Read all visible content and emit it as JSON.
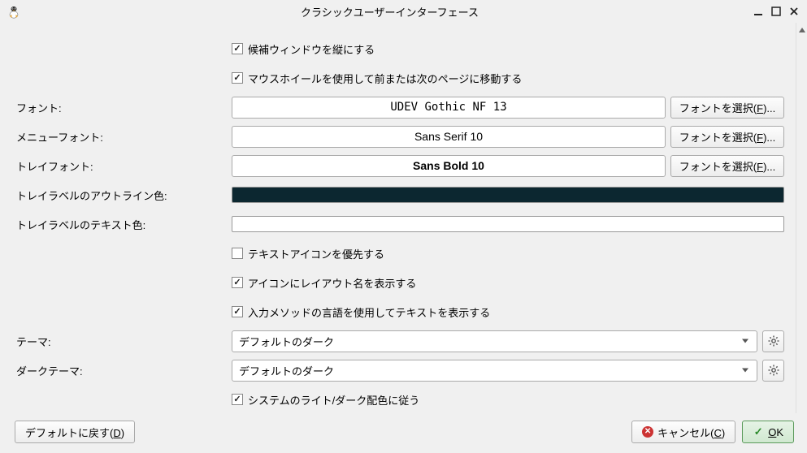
{
  "window": {
    "title": "クラシックユーザーインターフェース"
  },
  "checkboxes": {
    "vertical_candidate": {
      "label": "候補ウィンドウを縦にする",
      "checked": true
    },
    "wheel_paging": {
      "label": "マウスホイールを使用して前または次のページに移動する",
      "checked": true
    },
    "prefer_text_icon": {
      "label": "テキストアイコンを優先する",
      "checked": false
    },
    "show_layout_name": {
      "label": "アイコンにレイアウト名を表示する",
      "checked": true
    },
    "use_im_language": {
      "label": "入力メソッドの言語を使用してテキストを表示する",
      "checked": true
    },
    "follow_system_theme": {
      "label": "システムのライト/ダーク配色に従う",
      "checked": true
    }
  },
  "labels": {
    "font": "フォント:",
    "menu_font": "メニューフォント:",
    "tray_font": "トレイフォント:",
    "tray_outline_color": "トレイラベルのアウトライン色:",
    "tray_text_color": "トレイラベルのテキスト色:",
    "theme": "テーマ:",
    "dark_theme": "ダークテーマ:"
  },
  "fonts": {
    "main": "UDEV Gothic NF 13",
    "menu": "Sans Serif 10",
    "tray": "Sans Bold 10"
  },
  "colors": {
    "tray_outline": "#0c2730",
    "tray_text": "#ffffff"
  },
  "buttons": {
    "font_select_prefix": "フォントを選択(",
    "font_select_letter": "F",
    "font_select_suffix": ")...",
    "reset_default_prefix": "デフォルトに戻す(",
    "reset_default_letter": "D",
    "reset_default_suffix": ")",
    "cancel_prefix": "キャンセル(",
    "cancel_letter": "C",
    "cancel_suffix": ")",
    "ok_letter": "O",
    "ok_suffix": "K"
  },
  "theme": {
    "value": "デフォルトのダーク"
  },
  "dark_theme": {
    "value": "デフォルトのダーク"
  }
}
